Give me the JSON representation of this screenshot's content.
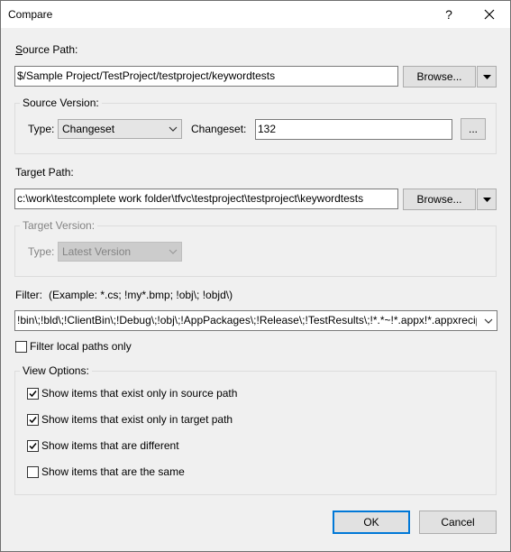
{
  "window": {
    "title": "Compare",
    "help": "?",
    "close": "✕"
  },
  "source": {
    "path_label": "Source Path:",
    "path_value": "$/Sample Project/TestProject/testproject/keywordtests",
    "browse_label": "Browse...",
    "version_group": "Source Version:",
    "type_label": "Type:",
    "type_value": "Changeset",
    "changeset_label": "Changeset:",
    "changeset_value": "132",
    "ellipsis_label": "..."
  },
  "target": {
    "path_label": "Target Path:",
    "path_value": "c:\\work\\testcomplete work folder\\tfvc\\testproject\\testproject\\keywordtests",
    "browse_label": "Browse...",
    "version_group": "Target Version:",
    "type_label": "Type:",
    "type_value": "Latest Version"
  },
  "filter": {
    "label": "Filter:",
    "example": "(Example: *.cs; !my*.bmp; !obj\\; !objd\\)",
    "value": "!bin\\;!bld\\;!ClientBin\\;!Debug\\;!obj\\;!AppPackages\\;!Release\\;!TestResults\\;!*.*~!*.appx!*.appxrecip",
    "local_only_label": "Filter local paths only",
    "local_only_checked": false
  },
  "view_options": {
    "group": "View Options:",
    "items": [
      {
        "label": "Show items that exist only in source path",
        "checked": true
      },
      {
        "label": "Show items that exist only in target path",
        "checked": true
      },
      {
        "label": "Show items that are different",
        "checked": true
      },
      {
        "label": "Show items that are the same",
        "checked": false
      }
    ]
  },
  "footer": {
    "ok": "OK",
    "cancel": "Cancel"
  }
}
